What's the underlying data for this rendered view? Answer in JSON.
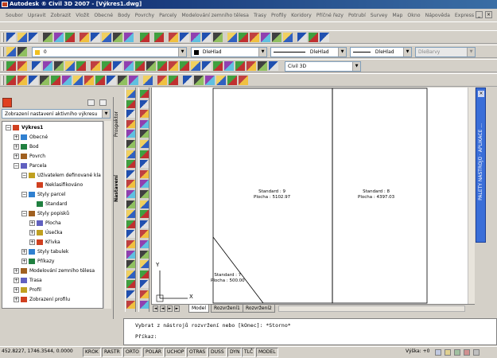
{
  "window": {
    "title": "Autodesk ® Civil 3D 2007 - [Výkres1.dwg]"
  },
  "menu": [
    "Soubor",
    "Upravit",
    "Zobrazit",
    "Vložit",
    "Obecné",
    "Body",
    "Povrchy",
    "Parcely",
    "Modelování zemního tělesa",
    "Trasy",
    "Profily",
    "Koridory",
    "Příčné řezy",
    "Potrubí",
    "Survey",
    "Map",
    "Okno",
    "Nápověda",
    "Express"
  ],
  "toolbar2": {
    "layer": "0"
  },
  "toolbar3": {
    "color": "DleHlad",
    "linetype": "DleHlad",
    "lineweight": "DleHlad",
    "plotstyle": "DleBarvy"
  },
  "toolbar4": {
    "workspace": "Civil 3D"
  },
  "prospector": {
    "header_combo": "Zobrazení nastavení aktivního výkresu",
    "side_tabs": {
      "prospector": "Prospektor",
      "settings": "Nastavení"
    },
    "tree": [
      {
        "label": "Výkres1",
        "level": 0,
        "pm": "−",
        "icon": "drawing-icon"
      },
      {
        "label": "Obecné",
        "level": 1,
        "pm": "+",
        "icon": "general-icon"
      },
      {
        "label": "Bod",
        "level": 1,
        "pm": "+",
        "icon": "point-icon"
      },
      {
        "label": "Povrch",
        "level": 1,
        "pm": "+",
        "icon": "surface-icon"
      },
      {
        "label": "Parcela",
        "level": 1,
        "pm": "−",
        "icon": "parcel-icon"
      },
      {
        "label": "Uživatelem definované kla",
        "level": 2,
        "pm": "−",
        "icon": "style-icon"
      },
      {
        "label": "Neklasifikováno",
        "level": 3,
        "pm": "",
        "icon": "item-icon"
      },
      {
        "label": "Styly parcel",
        "level": 2,
        "pm": "−",
        "icon": "style-icon"
      },
      {
        "label": "Standard",
        "level": 3,
        "pm": "",
        "icon": "item-icon"
      },
      {
        "label": "Styly popisků",
        "level": 2,
        "pm": "−",
        "icon": "style-icon"
      },
      {
        "label": "Plocha",
        "level": 3,
        "pm": "+",
        "icon": "style-icon"
      },
      {
        "label": "Úsečka",
        "level": 3,
        "pm": "+",
        "icon": "style-icon"
      },
      {
        "label": "Křivka",
        "level": 3,
        "pm": "+",
        "icon": "style-icon"
      },
      {
        "label": "Styly tabulek",
        "level": 2,
        "pm": "+",
        "icon": "style-icon"
      },
      {
        "label": "Příkazy",
        "level": 2,
        "pm": "+",
        "icon": "style-icon"
      },
      {
        "label": "Modelování zemního tělesa",
        "level": 1,
        "pm": "+",
        "icon": "grading-icon"
      },
      {
        "label": "Trasa",
        "level": 1,
        "pm": "+",
        "icon": "alignment-icon"
      },
      {
        "label": "Profil",
        "level": 1,
        "pm": "+",
        "icon": "profile-icon"
      },
      {
        "label": "Zobrazení profilu",
        "level": 1,
        "pm": "+",
        "icon": "profile-view-icon"
      }
    ]
  },
  "drawing": {
    "parcels": [
      {
        "name": "Standard : 9",
        "area": "Plocha : 5102.97"
      },
      {
        "name": "Standard : 8",
        "area": "Plocha : 4397.03"
      },
      {
        "name": "Standard : 7",
        "area": "Plocha : 500.00"
      }
    ],
    "ucs_y": "Y",
    "ucs_x": "X"
  },
  "layout_tabs": [
    "Model",
    "Rozvržení1",
    "Rozvržení2"
  ],
  "tool_palette": {
    "label": "PALETY NÁSTROJŮ · APLIKACE ..."
  },
  "command": {
    "history": "Vybrat z nástrojů rozvržení nebo [kOnec]: *Storno*",
    "prompt": "Příkaz:"
  },
  "status": {
    "coords": "452.8227, 1746.3544, 0.0000",
    "toggles": [
      "KROK",
      "RASTR",
      "ORTO",
      "POLÁR",
      "UCHOP",
      "OTRAS",
      "DUSS",
      "DYN",
      "TLČ",
      "MODEL"
    ],
    "elevation": "Výška: +0"
  }
}
